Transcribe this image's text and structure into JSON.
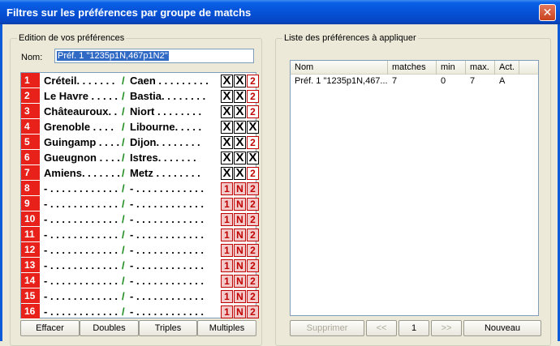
{
  "window": {
    "title": "Filtres sur les préférences par groupe de matchs",
    "close": "✕"
  },
  "left": {
    "legend": "Edition de vos préférences",
    "name_label": "Nom:",
    "name_value": "Préf. 1 \"1235p1N,467p1N2\"",
    "rows": [
      {
        "n": "1",
        "t1": "Créteil. . . . . . .",
        "t2": "Caen . . . . . . . . .",
        "c1": "X",
        "cN": "X",
        "c2": "2"
      },
      {
        "n": "2",
        "t1": "Le Havre . . . . .",
        "t2": "Bastia. . . . . . . .",
        "c1": "X",
        "cN": "X",
        "c2": "2"
      },
      {
        "n": "3",
        "t1": "Châteauroux. .",
        "t2": "Niort . . . . . . . .",
        "c1": "X",
        "cN": "X",
        "c2": "2"
      },
      {
        "n": "4",
        "t1": "Grenoble . . . .",
        "t2": "Libourne. . . . .",
        "c1": "X",
        "cN": "X",
        "c2": "X"
      },
      {
        "n": "5",
        "t1": "Guingamp . . . .",
        "t2": "Dijon. . . . . . . .",
        "c1": "X",
        "cN": "X",
        "c2": "2"
      },
      {
        "n": "6",
        "t1": "Gueugnon . . . .",
        "t2": "Istres. . . . . . .",
        "c1": "X",
        "cN": "X",
        "c2": "X"
      },
      {
        "n": "7",
        "t1": "Amiens. . . . . . .",
        "t2": "Metz . . . . . . . .",
        "c1": "X",
        "cN": "X",
        "c2": "2"
      },
      {
        "n": "8",
        "t1": "- . . . . . . . . . . . .",
        "t2": "- . . . . . . . . . . . .",
        "c1": "1",
        "cN": "N",
        "c2": "2"
      },
      {
        "n": "9",
        "t1": "- . . . . . . . . . . . .",
        "t2": "- . . . . . . . . . . . .",
        "c1": "1",
        "cN": "N",
        "c2": "2"
      },
      {
        "n": "10",
        "t1": "- . . . . . . . . . . . .",
        "t2": "- . . . . . . . . . . . .",
        "c1": "1",
        "cN": "N",
        "c2": "2"
      },
      {
        "n": "11",
        "t1": "- . . . . . . . . . . . .",
        "t2": "- . . . . . . . . . . . .",
        "c1": "1",
        "cN": "N",
        "c2": "2"
      },
      {
        "n": "12",
        "t1": "- . . . . . . . . . . . .",
        "t2": "- . . . . . . . . . . . .",
        "c1": "1",
        "cN": "N",
        "c2": "2"
      },
      {
        "n": "13",
        "t1": "- . . . . . . . . . . . .",
        "t2": "- . . . . . . . . . . . .",
        "c1": "1",
        "cN": "N",
        "c2": "2"
      },
      {
        "n": "14",
        "t1": "- . . . . . . . . . . . .",
        "t2": "- . . . . . . . . . . . .",
        "c1": "1",
        "cN": "N",
        "c2": "2"
      },
      {
        "n": "15",
        "t1": "- . . . . . . . . . . . .",
        "t2": "- . . . . . . . . . . . .",
        "c1": "1",
        "cN": "N",
        "c2": "2"
      },
      {
        "n": "16",
        "t1": "- . . . . . . . . . . . .",
        "t2": "- . . . . . . . . . . . .",
        "c1": "1",
        "cN": "N",
        "c2": "2"
      }
    ],
    "buttons": {
      "effacer": "Effacer",
      "doubles": "Doubles",
      "triples": "Triples",
      "multiples": "Multiples"
    }
  },
  "right": {
    "legend": "Liste des préférences à appliquer",
    "columns": {
      "nom": "Nom",
      "matches": "matches",
      "min": "min",
      "max": "max.",
      "act": "Act."
    },
    "rows": [
      {
        "nom": "Préf. 1 \"1235p1N,467...",
        "matches": "7",
        "min": "0",
        "max": "7",
        "act": "A"
      }
    ],
    "buttons": {
      "supprimer": "Supprimer",
      "prev": "<<",
      "page": "1",
      "next": ">>",
      "nouveau": "Nouveau"
    }
  },
  "colors": {
    "accent_red": "#e8221b",
    "title_blue": "#0552d7",
    "slash_green": "#1a8a1a"
  }
}
